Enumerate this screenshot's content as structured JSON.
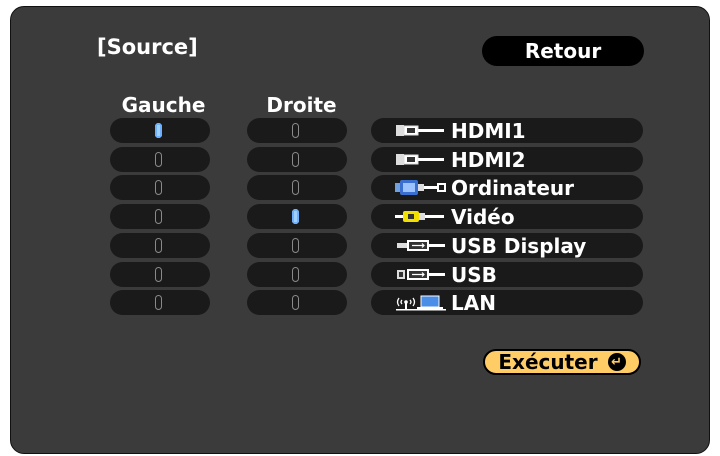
{
  "title": "[Source]",
  "back_label": "Retour",
  "columns": {
    "left": "Gauche",
    "right": "Droite"
  },
  "sources": [
    {
      "label": "HDMI1",
      "icon": "hdmi-icon"
    },
    {
      "label": "HDMI2",
      "icon": "hdmi-icon"
    },
    {
      "label": "Ordinateur",
      "icon": "vga-computer-icon"
    },
    {
      "label": "Vidéo",
      "icon": "rca-video-icon"
    },
    {
      "label": "USB Display",
      "icon": "usb-display-icon"
    },
    {
      "label": "USB",
      "icon": "usb-icon"
    },
    {
      "label": "LAN",
      "icon": "lan-icon"
    }
  ],
  "selected": {
    "left": "HDMI1",
    "right": "Vidéo"
  },
  "execute_label": "Exécuter",
  "colors": {
    "background": "#3b3b3b",
    "row": "#1a1a1a",
    "accent": "#ffcc66",
    "selected_mark": "#6db0ff"
  }
}
